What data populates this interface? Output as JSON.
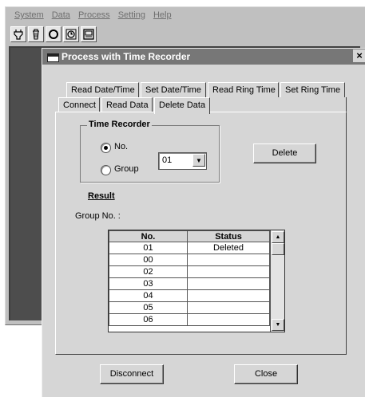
{
  "main_window": {
    "menu": [
      "System",
      "Data",
      "Process",
      "Setting",
      "Help"
    ],
    "toolbar_icons": [
      "plug-icon",
      "trash-icon",
      "circle-icon",
      "alarm-icon",
      "recorder-icon"
    ]
  },
  "dialog": {
    "title": "Process with Time Recorder",
    "close_label": "×",
    "tabs_row1": [
      "Read Date/Time",
      "Set Date/Time",
      "Read Ring Time",
      "Set Ring Time"
    ],
    "tabs_row2": [
      "Connect",
      "Read Data",
      "Delete Data"
    ],
    "active_tab": "Delete Data",
    "time_recorder": {
      "legend": "Time Recorder",
      "option_no": "No.",
      "option_group": "Group",
      "selected": "No.",
      "combo_value": "01"
    },
    "delete_button": "Delete",
    "result_label": "Result",
    "group_no_label": "Group No. :",
    "table": {
      "columns": [
        "No.",
        "Status"
      ],
      "rows": [
        [
          "01",
          "Deleted"
        ],
        [
          "00",
          ""
        ],
        [
          "02",
          ""
        ],
        [
          "03",
          ""
        ],
        [
          "04",
          ""
        ],
        [
          "05",
          ""
        ],
        [
          "06",
          ""
        ]
      ]
    },
    "disconnect_button": "Disconnect",
    "close_button": "Close"
  }
}
